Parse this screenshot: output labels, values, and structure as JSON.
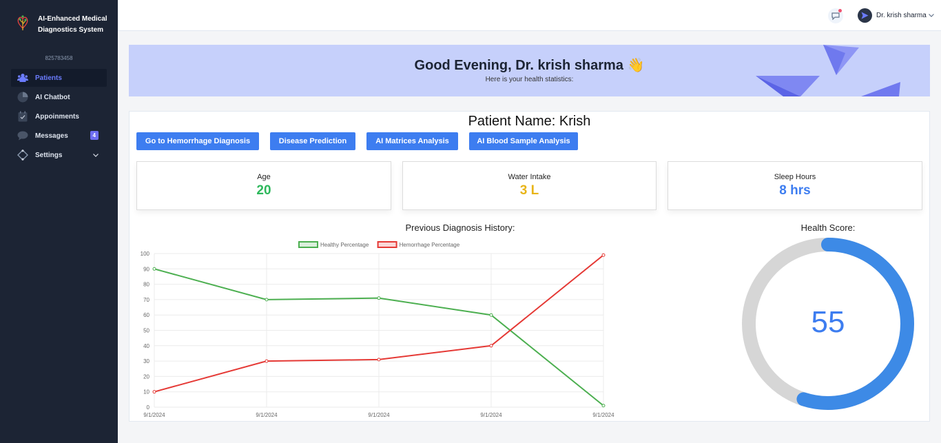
{
  "sidebar": {
    "brand_title": "AI-Enhanced Medical Diagnostics System",
    "account_id": "825783458",
    "items": [
      {
        "label": "Patients",
        "icon": "patients-icon"
      },
      {
        "label": "AI Chatbot",
        "icon": "chatbot-icon"
      },
      {
        "label": "Appoinments",
        "icon": "calendar-icon"
      },
      {
        "label": "Messages",
        "icon": "message-icon",
        "badge": "4"
      },
      {
        "label": "Settings",
        "icon": "settings-icon"
      }
    ]
  },
  "header": {
    "user_name": "Dr. krish sharma"
  },
  "banner": {
    "greeting": "Good Evening, Dr. krish sharma 👋",
    "subtitle": "Here is your health statistics:"
  },
  "patient": {
    "title": "Patient Name: Krish"
  },
  "actions": [
    "Go to Hemorrhage Diagnosis",
    "Disease Prediction",
    "AI Matrices Analysis",
    "AI Blood Sample Analysis"
  ],
  "stats": [
    {
      "label": "Age",
      "value": "20",
      "color": "#2eb85c"
    },
    {
      "label": "Water Intake",
      "value": "3 L",
      "color": "#e8b416"
    },
    {
      "label": "Sleep Hours",
      "value": "8 hrs",
      "color": "#3d7df0"
    }
  ],
  "history_title": "Previous Diagnosis History:",
  "score_title": "Health Score:",
  "health_score": {
    "value": 55,
    "max": 100,
    "text": "55"
  },
  "chart_data": {
    "type": "line",
    "x": [
      "9/1/2024",
      "9/1/2024",
      "9/1/2024",
      "9/1/2024",
      "9/1/2024"
    ],
    "ylim": [
      0,
      100
    ],
    "yticks": [
      "0",
      "10",
      "20",
      "30",
      "40",
      "50",
      "60",
      "70",
      "80",
      "90",
      "100"
    ],
    "series": [
      {
        "name": "Healthy Percentage",
        "values": [
          90,
          70,
          71,
          60,
          1
        ],
        "color": "#4caf50"
      },
      {
        "name": "Hemorrhage Percentage",
        "values": [
          10,
          30,
          31,
          40,
          99
        ],
        "color": "#e53935"
      }
    ],
    "legend": "top",
    "grid": true
  }
}
